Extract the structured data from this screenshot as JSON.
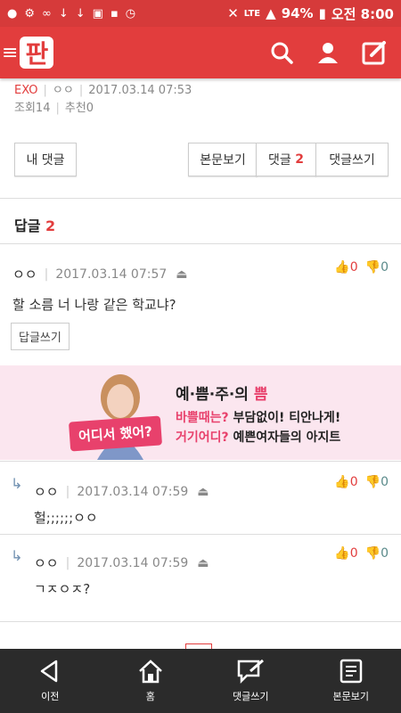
{
  "status_bar": {
    "battery": "94%",
    "time": "오전 8:00",
    "network": "LTE"
  },
  "app": {
    "logo_text": "판"
  },
  "post_meta": {
    "category": "EXO",
    "author": "ㅇㅇ",
    "date": "2017.03.14 07:53",
    "views": "조회14",
    "recommends": "추천0"
  },
  "buttons": {
    "my_comments": "내 댓글",
    "view_post": "본문보기",
    "comments_label": "댓글",
    "comments_count": "2",
    "write_comment": "댓글쓰기"
  },
  "replies": {
    "title": "답글",
    "count": "2"
  },
  "comments": [
    {
      "author": "ㅇㅇ",
      "date": "2017.03.14 07:57",
      "text": "할 소름 너 나랑 같은 학교냐?",
      "up": "0",
      "down": "0",
      "reply_button": "답글쓰기"
    },
    {
      "author": "ㅇㅇ",
      "date": "2017.03.14 07:59",
      "text": "헐;;;;;;ㅇㅇ",
      "up": "0",
      "down": "0"
    },
    {
      "author": "ㅇㅇ",
      "date": "2017.03.14 07:59",
      "text": "ㄱㅈㅇㅈ?",
      "up": "0",
      "down": "0"
    }
  ],
  "ad": {
    "title_prefix": "예·쁨·주·의 ",
    "title_highlight": "쁨",
    "line2_highlight": "바쁠때는? ",
    "line2_rest": "부담없이! 티안나게!",
    "line3_highlight": "거기어디? ",
    "line3_rest": "예쁜여자들의 아지트",
    "badge": "어디서 했어?"
  },
  "bottom_nav": [
    {
      "label": "이전"
    },
    {
      "label": "홈"
    },
    {
      "label": "댓글쓰기"
    },
    {
      "label": "본문보기"
    }
  ],
  "colors": {
    "brand": "#e23d3d",
    "ad_pink": "#e8416c",
    "nav_bg": "#2b2b2b"
  }
}
